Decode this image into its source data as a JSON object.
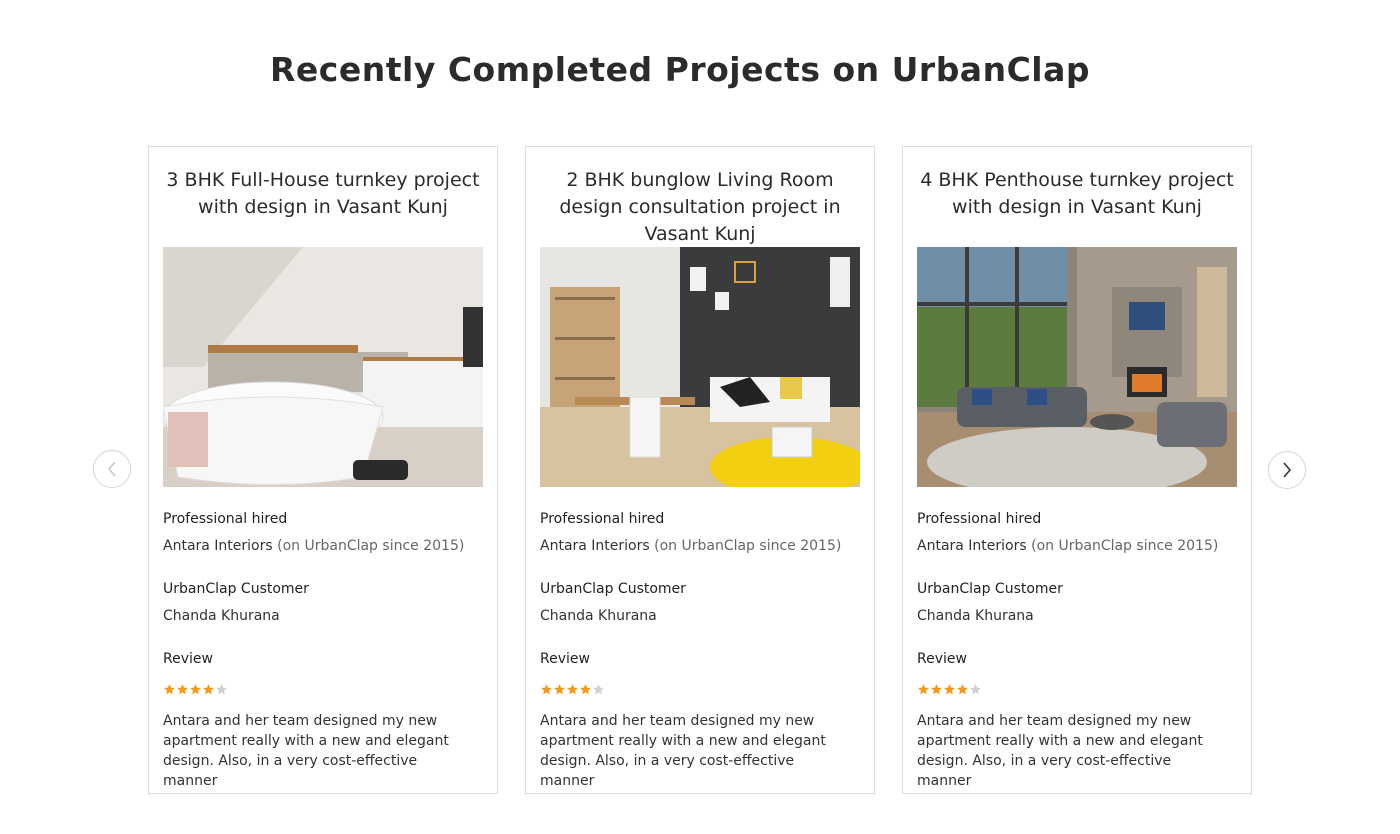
{
  "heading": "Recently Completed Projects on UrbanClap",
  "labels": {
    "professional": "Professional hired",
    "customer": "UrbanClap Customer",
    "review": "Review"
  },
  "colors": {
    "star_filled": "#f29a1f",
    "star_empty": "#d0d0d0",
    "border": "#dcdcdc"
  },
  "icons": {
    "prev": "chevron-left-icon",
    "next": "chevron-right-icon"
  },
  "projects": [
    {
      "title": "3 BHK Full-House turnkey project with design in Vasant Kunj",
      "image": "bathroom-photo",
      "professional_name": "Antara Interiors",
      "professional_since": "(on UrbanClap since 2015)",
      "customer_name": "Chanda Khurana",
      "rating": 4,
      "rating_max": 5,
      "review": "Antara and her team designed my new apartment really with a new and elegant design. Also, in a very cost-effective manner"
    },
    {
      "title": "2 BHK bunglow Living Room design consultation project in Vasant Kunj",
      "image": "living-room-photo",
      "professional_name": "Antara Interiors",
      "professional_since": "(on UrbanClap since 2015)",
      "customer_name": "Chanda Khurana",
      "rating": 4,
      "rating_max": 5,
      "review": "Antara and her team designed my new apartment really with a new and elegant design. Also, in a very cost-effective manner"
    },
    {
      "title": "4 BHK Penthouse turnkey project with design in Vasant Kunj",
      "image": "penthouse-lounge-photo",
      "professional_name": "Antara Interiors",
      "professional_since": "(on UrbanClap since 2015)",
      "customer_name": "Chanda Khurana",
      "rating": 4,
      "rating_max": 5,
      "review": "Antara and her team designed my new apartment really with a new and elegant design. Also, in a very cost-effective manner"
    }
  ]
}
